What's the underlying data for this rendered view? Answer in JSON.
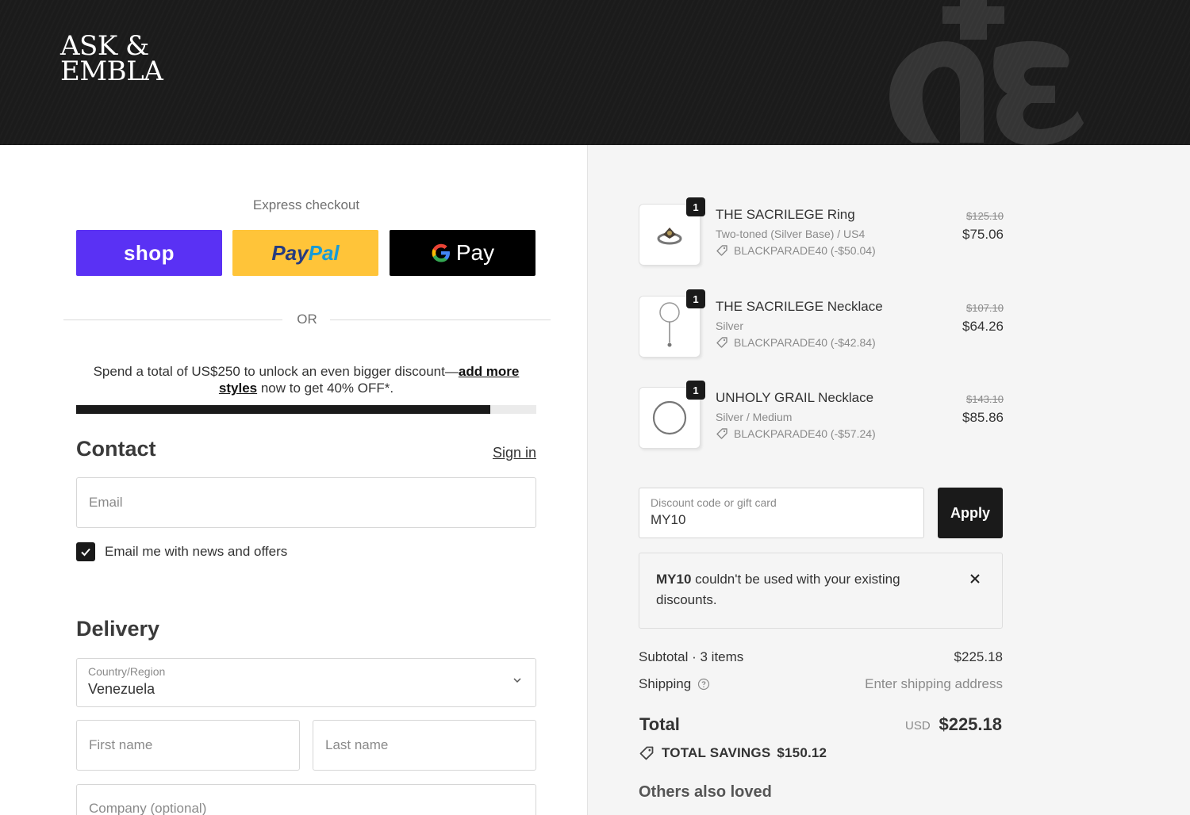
{
  "header": {
    "logo_line1": "ASK &",
    "logo_line2": "EMBLA"
  },
  "express": {
    "title": "Express checkout",
    "shop_label": "shop",
    "paypal_label_a": "Pay",
    "paypal_label_b": "Pal",
    "gpay_label": "Pay",
    "or_label": "OR"
  },
  "promo": {
    "text_before": "Spend a total of US$250 to unlock an even bigger discount—",
    "link1": "add more",
    "link2": "styles",
    "text_after": " now to get 40% OFF*.",
    "progress_fraction": 0.9
  },
  "contact": {
    "title": "Contact",
    "signin_label": "Sign in",
    "email_placeholder": "Email",
    "newsletter_label": "Email me with news and offers",
    "newsletter_checked": true
  },
  "delivery": {
    "title": "Delivery",
    "country_label": "Country/Region",
    "country_value": "Venezuela",
    "first_name_placeholder": "First name",
    "last_name_placeholder": "Last name",
    "company_placeholder": "Company (optional)"
  },
  "cart": {
    "items": [
      {
        "qty": "1",
        "name": "THE SACRILEGE Ring",
        "variant": "Two-toned (Silver Base) / US4",
        "discount": "BLACKPARADE40 (-$50.04)",
        "old_price": "$125.10",
        "price": "$75.06"
      },
      {
        "qty": "1",
        "name": "THE SACRILEGE Necklace",
        "variant": "Silver",
        "discount": "BLACKPARADE40 (-$42.84)",
        "old_price": "$107.10",
        "price": "$64.26"
      },
      {
        "qty": "1",
        "name": "UNHOLY GRAIL Necklace",
        "variant": "Silver / Medium",
        "discount": "BLACKPARADE40 (-$57.24)",
        "old_price": "$143.10",
        "price": "$85.86"
      }
    ],
    "discount_label": "Discount code or gift card",
    "discount_value": "MY10",
    "apply_label": "Apply",
    "error_code": "MY10",
    "error_text": " couldn't be used with your existing discounts.",
    "subtotal_label": "Subtotal · 3 items",
    "subtotal_value": "$225.18",
    "shipping_label": "Shipping",
    "shipping_value": "Enter shipping address",
    "total_label": "Total",
    "currency": "USD",
    "total_value": "$225.18",
    "savings_label": "TOTAL SAVINGS",
    "savings_value": "$150.12",
    "others_label": "Others also loved"
  },
  "colors": {
    "shop": "#5a31f4",
    "paypal": "#ffc439",
    "gpay": "#000000",
    "header_bg": "#1b1b1b",
    "summary_bg": "#f5f5f5"
  },
  "icons": [
    "google-g-icon",
    "checkbox-check-icon",
    "chevron-down-icon",
    "tag-icon",
    "help-circle-icon",
    "close-icon",
    "monogram-logo"
  ]
}
